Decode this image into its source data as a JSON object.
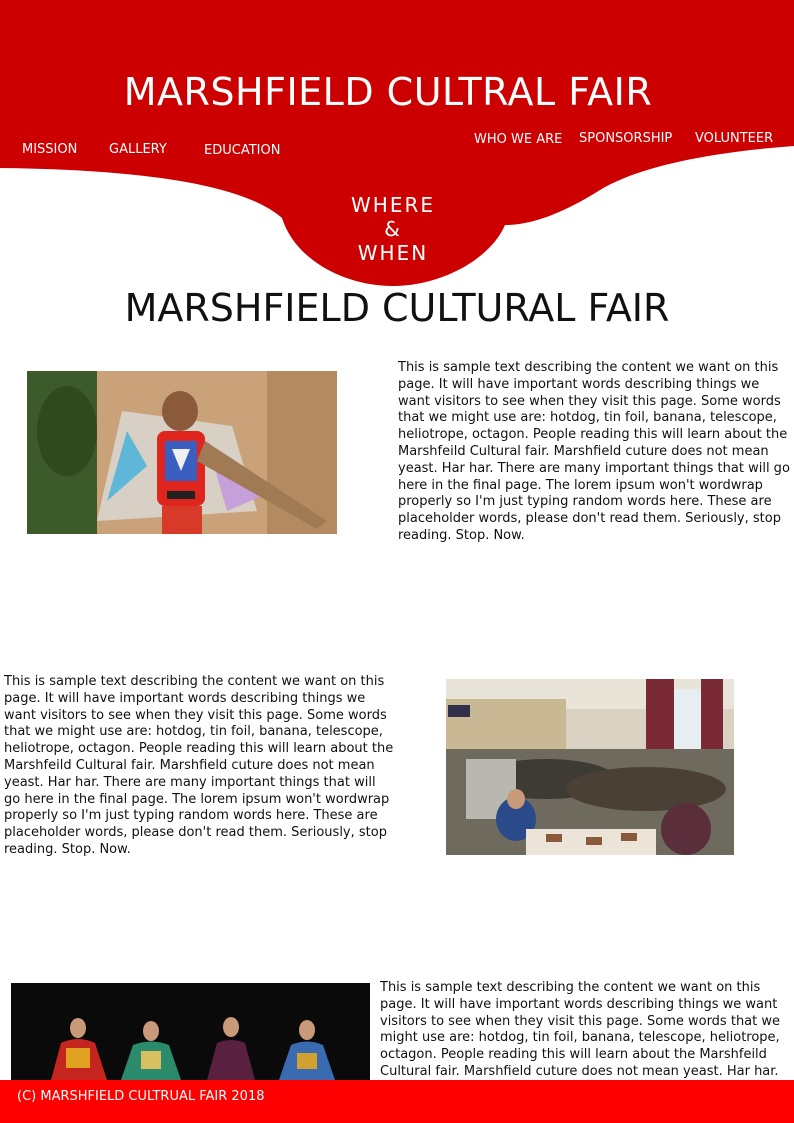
{
  "colors": {
    "brand_red": "#cc0000",
    "footer_red": "#ff0000",
    "text_white": "#ffffff"
  },
  "header": {
    "title": "MARSHFIELD CULTRAL FAIR",
    "nav_left": [
      "MISSION",
      "GALLERY",
      "EDUCATION"
    ],
    "nav_right": [
      "WHO WE ARE",
      "SPONSORSHIP",
      "VOLUNTEER"
    ],
    "badge": {
      "line1": "WHERE",
      "line2": "&",
      "line3": "WHEN"
    }
  },
  "main": {
    "title": "MARSHFIELD CULTURAL FAIR",
    "sections": [
      {
        "text": "This is sample text describing the content we want on this page. It will have important words describing things we want visitors to see when they visit this page. Some words that we might use are: hotdog, tin foil, banana, telescope, heliotrope, octagon. People reading this will learn about the Marshfeild Cultural fair. Marshfield cuture does not mean yeast. Har har. There are many important things that will go here in the final page. The lorem ipsum won't wordwrap properly so I'm just typing random words here. These are placeholder words, please don't read them. Seriously, stop reading. Stop. Now."
      },
      {
        "text": "This is sample text describing the content we want on this page. It will have important words describing things we want visitors to see when they visit this page. Some words that we might use are: hotdog, tin foil, banana, telescope, heliotrope, octagon. People reading this will learn about the Marshfeild Cultural fair. Marshfield cuture does not mean yeast. Har har. There are many important things that will go here in the final page. The lorem ipsum won't wordwrap properly so I'm just typing random words here. These are placeholder words, please don't read them. Seriously, stop reading. Stop. Now."
      },
      {
        "text": "This is sample text describing the content we want on this page. It will have important words describing things we want visitors to see when they visit this page. Some words that we might use are: hotdog, tin foil, banana, telescope, heliotrope, octagon. People reading this will learn about the Marshfeild Cultural fair. Marshfield cuture does not mean yeast. Har har. There are many important things that will go here in the final page."
      }
    ]
  },
  "footer": {
    "text": "(C) MARSHFIELD CULTRUAL FAIR 2018"
  }
}
